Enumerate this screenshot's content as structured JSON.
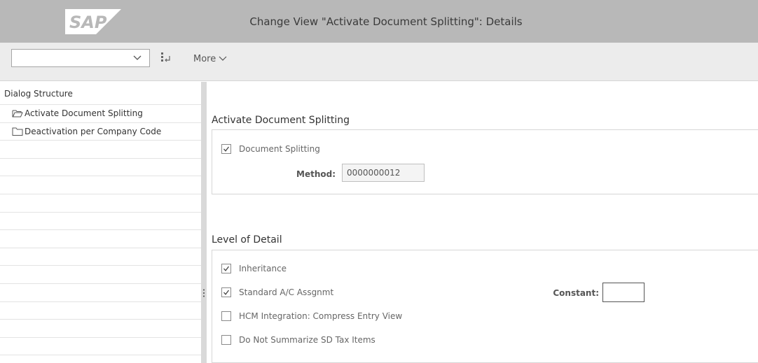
{
  "header": {
    "logo_text": "SAP",
    "title": "Change View \"Activate Document Splitting\": Details"
  },
  "toolbar": {
    "command_field_value": "",
    "more_label": "More"
  },
  "dialog_structure": {
    "title": "Dialog Structure",
    "items": [
      {
        "label": "Activate Document Splitting",
        "icon": "open-folder-icon"
      },
      {
        "label": "Deactivation per Company Code",
        "icon": "folder-icon"
      }
    ]
  },
  "activate_section": {
    "title": "Activate Document Splitting",
    "document_splitting": {
      "label": "Document Splitting",
      "checked": true
    },
    "method": {
      "label": "Method:",
      "value": "0000000012"
    }
  },
  "detail_section": {
    "title": "Level of Detail",
    "inheritance": {
      "label": "Inheritance",
      "checked": true
    },
    "standard_ac": {
      "label": "Standard A/C Assgnmt",
      "checked": true
    },
    "hcm": {
      "label": "HCM Integration: Compress Entry View",
      "checked": false
    },
    "sd_tax": {
      "label": "Do Not Summarize SD Tax Items",
      "checked": false
    },
    "constant": {
      "label": "Constant:",
      "value": ""
    }
  },
  "colors": {
    "titlebar": "#b8b8b8",
    "toolbar": "#ececec",
    "splitter": "#d9d9d9"
  }
}
